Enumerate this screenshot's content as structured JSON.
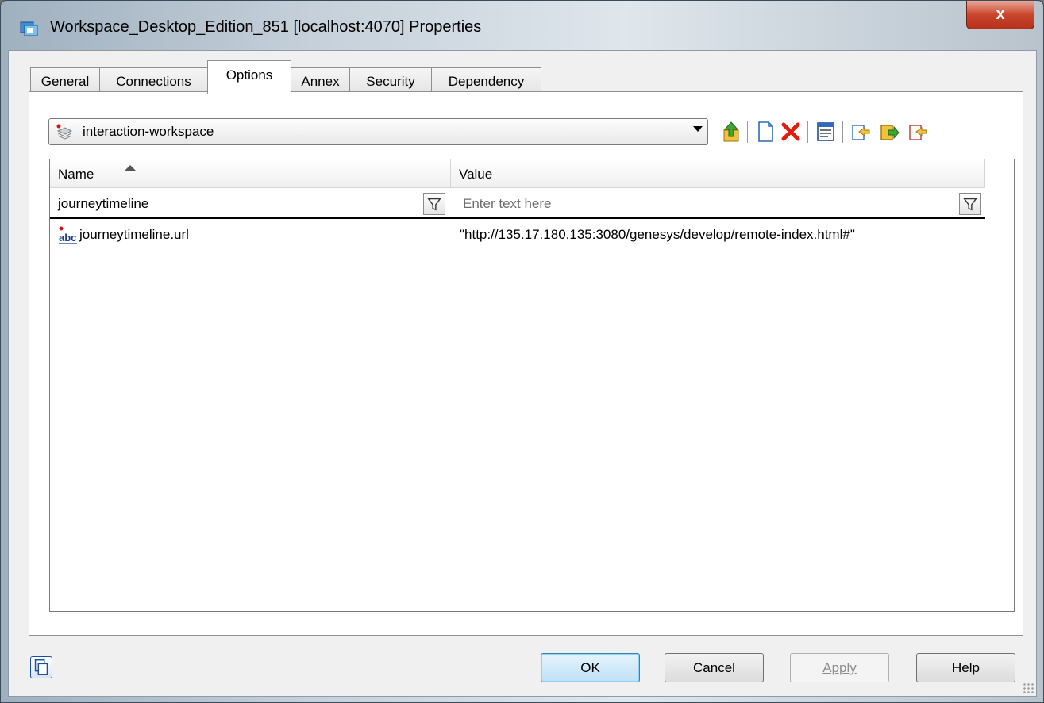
{
  "window": {
    "title": "Workspace_Desktop_Edition_851 [localhost:4070] Properties",
    "close_label": "x"
  },
  "tabs": [
    {
      "label": "General"
    },
    {
      "label": "Connections"
    },
    {
      "label": "Options"
    },
    {
      "label": "Annex"
    },
    {
      "label": "Security"
    },
    {
      "label": "Dependency"
    }
  ],
  "active_tab": "Options",
  "section_select": {
    "value": "interaction-workspace"
  },
  "toolbar": {
    "icons": [
      "up-folder-icon",
      "new-document-icon",
      "delete-icon",
      "properties-icon",
      "import-icon",
      "export-icon",
      "compare-icon"
    ]
  },
  "grid": {
    "columns": [
      {
        "label": "Name"
      },
      {
        "label": "Value"
      }
    ],
    "sort_column": "Name",
    "filter": {
      "name_value": "journeytimeline",
      "value_placeholder": "Enter text here"
    },
    "rows": [
      {
        "name": "journeytimeline.url",
        "value": "\"http://135.17.180.135:3080/genesys/develop/remote-index.html#\"",
        "type_icon": "string-abc-icon"
      }
    ]
  },
  "buttons": {
    "ok": "OK",
    "cancel": "Cancel",
    "apply": "Apply",
    "help": "Help"
  },
  "colors": {
    "delete_icon": "#e01b10",
    "default_button": "#bfe1f6",
    "close_button": "#c9462c"
  }
}
